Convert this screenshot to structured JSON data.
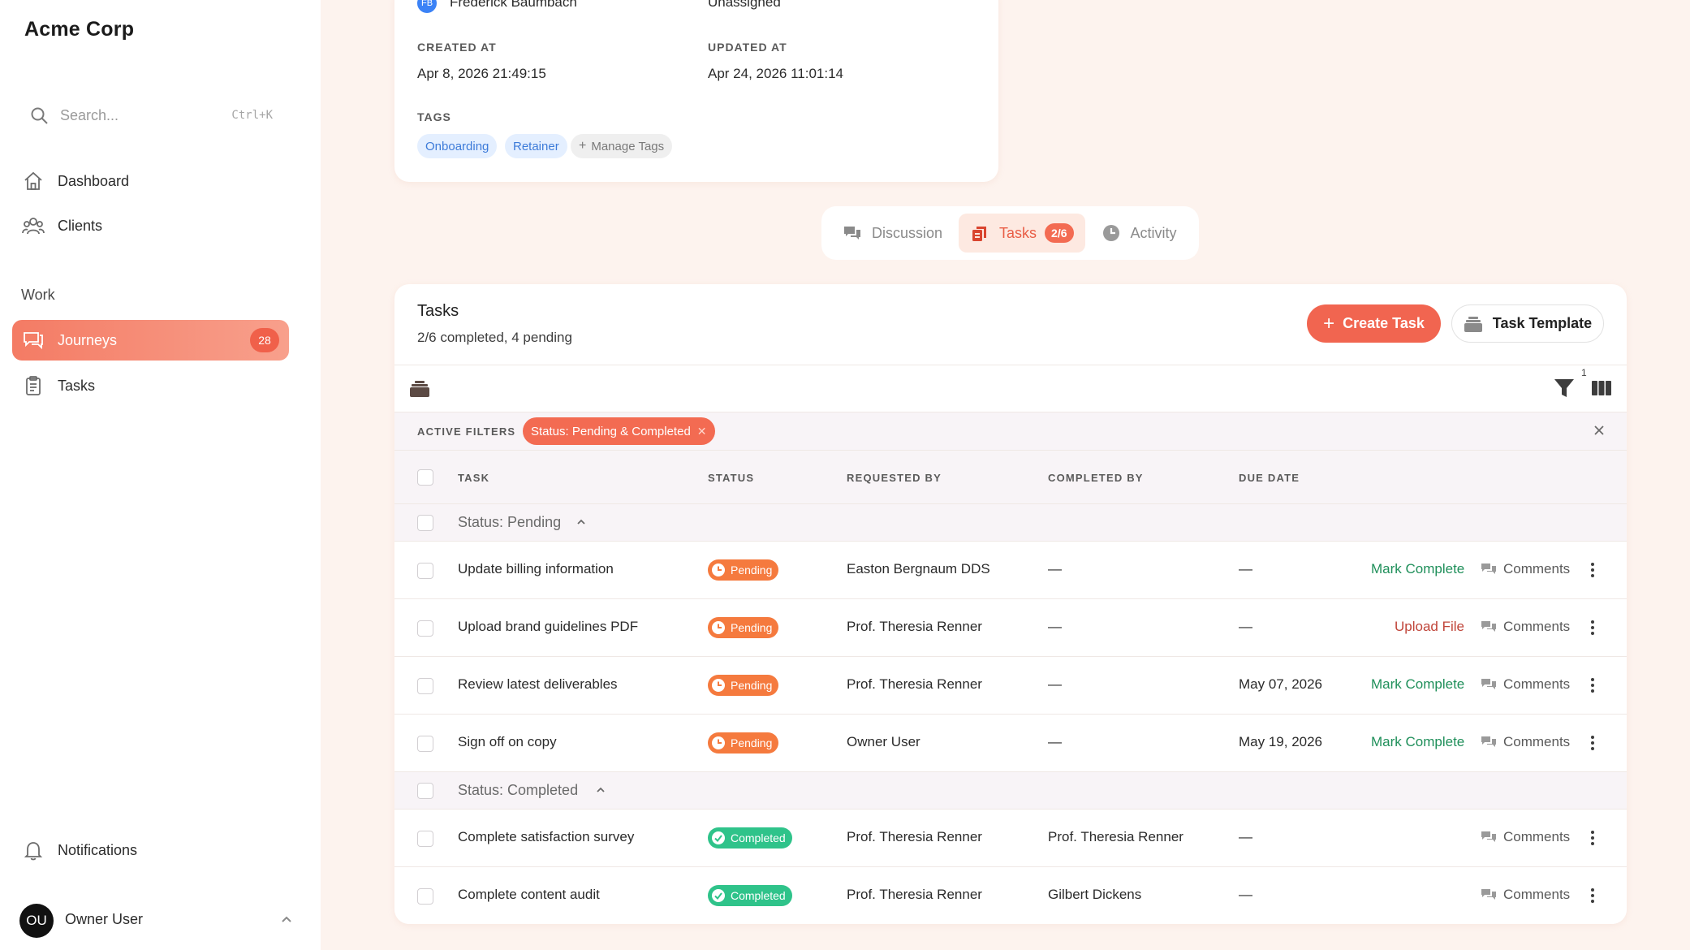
{
  "sidebar": {
    "brand": "Acme Corp",
    "search": {
      "placeholder": "Search...",
      "shortcut": "Ctrl+K"
    },
    "nav": [
      {
        "label": "Dashboard",
        "icon": "home-icon"
      },
      {
        "label": "Clients",
        "icon": "users-icon"
      }
    ],
    "work_label": "Work",
    "work_nav": [
      {
        "label": "Journeys",
        "icon": "chat-icon",
        "count": "28",
        "active": true
      },
      {
        "label": "Tasks",
        "icon": "clipboard-icon"
      }
    ],
    "notifications": "Notifications",
    "user": {
      "initials": "OU",
      "name": "Owner User"
    }
  },
  "details": {
    "assignee_initials": "FB",
    "assignee_name": "Frederick Baumbach",
    "assigned_to": "Unassigned",
    "created_label": "CREATED AT",
    "created_value": "Apr 8, 2026 21:49:15",
    "updated_label": "UPDATED AT",
    "updated_value": "Apr 24, 2026 11:01:14",
    "tags_label": "TAGS",
    "tags": [
      "Onboarding",
      "Retainer"
    ],
    "manage_tags": "Manage Tags"
  },
  "tabs": [
    {
      "label": "Discussion",
      "icon": "discussion-icon"
    },
    {
      "label": "Tasks",
      "icon": "tasks-icon",
      "badge": "2/6",
      "active": true
    },
    {
      "label": "Activity",
      "icon": "clock-icon"
    }
  ],
  "tasks": {
    "title": "Tasks",
    "summary": "2/6 completed, 4 pending",
    "create_label": "Create Task",
    "template_label": "Task Template",
    "filter_count": "1",
    "active_filters_label": "ACTIVE FILTERS",
    "active_filter_chip": "Status: Pending & Completed",
    "columns": [
      "TASK",
      "STATUS",
      "REQUESTED BY",
      "COMPLETED BY",
      "DUE DATE"
    ],
    "comments_label": "Comments",
    "groups": [
      {
        "label": "Status: Pending",
        "rows": [
          {
            "task": "Update billing information",
            "status": "Pending",
            "requested_by": "Easton Bergnaum DDS",
            "completed_by": "—",
            "due_date": "—",
            "action": "Mark Complete",
            "action_type": "complete"
          },
          {
            "task": "Upload brand guidelines PDF",
            "status": "Pending",
            "requested_by": "Prof. Theresia Renner",
            "completed_by": "—",
            "due_date": "—",
            "action": "Upload File",
            "action_type": "upload"
          },
          {
            "task": "Review latest deliverables",
            "status": "Pending",
            "requested_by": "Prof. Theresia Renner",
            "completed_by": "—",
            "due_date": "May 07, 2026",
            "action": "Mark Complete",
            "action_type": "complete"
          },
          {
            "task": "Sign off on copy",
            "status": "Pending",
            "requested_by": "Owner User",
            "completed_by": "—",
            "due_date": "May 19, 2026",
            "action": "Mark Complete",
            "action_type": "complete"
          }
        ]
      },
      {
        "label": "Status: Completed",
        "rows": [
          {
            "task": "Complete satisfaction survey",
            "status": "Completed",
            "requested_by": "Prof. Theresia Renner",
            "completed_by": "Prof. Theresia Renner",
            "due_date": "—"
          },
          {
            "task": "Complete content audit",
            "status": "Completed",
            "requested_by": "Prof. Theresia Renner",
            "completed_by": "Gilbert Dickens",
            "due_date": "—"
          }
        ]
      }
    ]
  }
}
